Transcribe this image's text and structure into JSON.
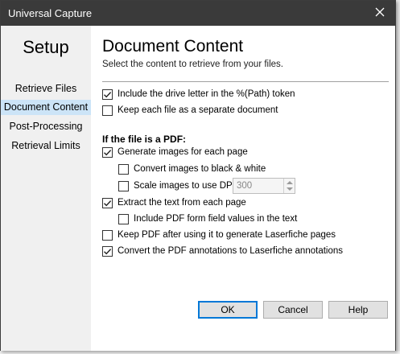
{
  "window": {
    "title": "Universal Capture"
  },
  "sidebar": {
    "heading": "Setup",
    "items": [
      {
        "label": "Retrieve Files",
        "active": false
      },
      {
        "label": "Document Content",
        "active": true
      },
      {
        "label": "Post-Processing",
        "active": false
      },
      {
        "label": "Retrieval Limits",
        "active": false
      }
    ]
  },
  "main": {
    "title": "Document Content",
    "subtitle": "Select the content to retrieve from your files.",
    "options": {
      "drive_letter": {
        "label": "Include the drive letter in the %(Path) token",
        "checked": true
      },
      "separate_doc": {
        "label": "Keep each file as a separate document",
        "checked": false
      }
    },
    "pdf_section": {
      "label": "If the file is a PDF:",
      "generate_images": {
        "label": "Generate images for each page",
        "checked": true
      },
      "black_white": {
        "label": "Convert images to black & white",
        "checked": false
      },
      "scale_dpi": {
        "label": "Scale images to use DPI:",
        "checked": false
      },
      "dpi_value": "300",
      "extract_text": {
        "label": "Extract the text from each page",
        "checked": true
      },
      "form_fields": {
        "label": "Include PDF form field values in the text",
        "checked": false
      },
      "keep_pdf": {
        "label": "Keep PDF after using it to generate Laserfiche pages",
        "checked": false
      },
      "annotations": {
        "label": "Convert the PDF annotations to Laserfiche annotations",
        "checked": true
      }
    }
  },
  "buttons": {
    "ok": "OK",
    "cancel": "Cancel",
    "help": "Help"
  },
  "colors": {
    "titlebar": "#3a3a3a",
    "sidebar": "#f0f0f0",
    "nav_active": "#cce4f7",
    "primary_border": "#0078d7"
  }
}
